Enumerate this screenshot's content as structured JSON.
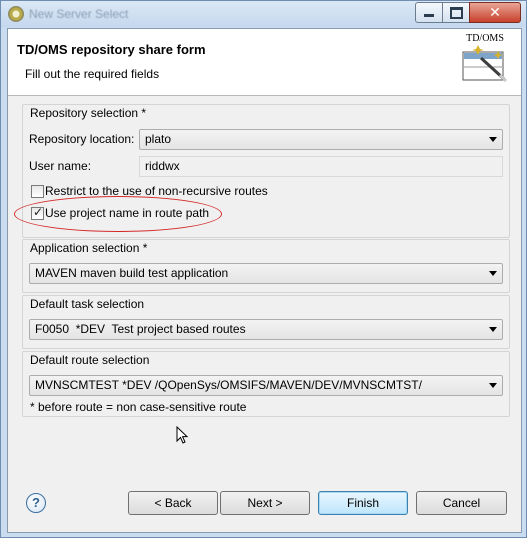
{
  "window": {
    "title": "New Server Select",
    "close_glyph": "✕"
  },
  "banner": {
    "title": "TD/OMS repository share form",
    "subtitle": "Fill out the required fields",
    "logo_caption": "TD/OMS"
  },
  "repository": {
    "group_title": "Repository selection *",
    "location_label": "Repository location:",
    "location_value": "plato",
    "user_label": "User name:",
    "user_value": "riddwx",
    "restrict_label": "Restrict to the use of non-recursive routes",
    "restrict_checked": false,
    "project_name_label": "Use project name in route path",
    "project_name_checked": true,
    "check_glyph": "✓"
  },
  "application": {
    "group_title": "Application selection *",
    "value": "MAVEN maven build test application"
  },
  "task": {
    "group_title": "Default task selection",
    "value": "F0050  *DEV  Test project based routes"
  },
  "route": {
    "group_title": "Default route selection",
    "value": "MVNSCMTEST *DEV /QOpenSys/OMSIFS/MAVEN/DEV/MVNSCMTST/",
    "note": "* before route = non case-sensitive route"
  },
  "buttons": {
    "help": "?",
    "back": "< Back",
    "next": "Next >",
    "finish": "Finish",
    "cancel": "Cancel"
  },
  "colors": {
    "annotation": "#d52a2a",
    "default_button": "#bee6fd"
  }
}
